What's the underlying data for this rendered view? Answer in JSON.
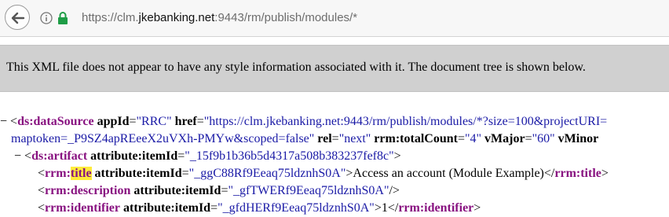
{
  "browser": {
    "url_prefix": "https://clm.",
    "url_host": "jkebanking.net",
    "url_suffix": ":9443/rm/publish/modules/*"
  },
  "notice": {
    "text": "This XML file does not appear to have any style information associated with it. The document tree is shown below."
  },
  "xml": {
    "toggle": "−",
    "lt": "<",
    "gt": ">",
    "close_lt": "</",
    "self_close": "/>",
    "eq": "=",
    "line1": {
      "tag": "ds:dataSource",
      "attr1": "appId",
      "val1": "\"RRC\"",
      "attr2": "href",
      "val2": "\"https://clm.jkebanking.net:9443/rm/publish/modules/*?size=100&projectURI="
    },
    "line2": {
      "val2_cont": "maptoken=_P9SZ4apREeeX2uVXh-PMYw&scoped=false\"",
      "attr3": "rel",
      "val3": "\"next\"",
      "attr4": "rrm:totalCount",
      "val4": "\"4\"",
      "attr5": "vMajor",
      "val5": "\"60\"",
      "attr6": "vMinor"
    },
    "line3": {
      "tag": "ds:artifact",
      "attr": "attribute:itemId",
      "val": "\"_15f9b1b36b5d4317a508b383237fef8c\""
    },
    "line4": {
      "tag_prefix": "rrm:",
      "tag_hl": "title",
      "attr": "attribute:itemId",
      "val": "\"_ggC88Rf9Eeaq75ldznhS0A\"",
      "text": "Access an account (Module Example)",
      "close_tag": "rrm:title"
    },
    "line5": {
      "tag": "rrm:description",
      "attr": "attribute:itemId",
      "val": "\"_gfTWERf9Eeaq75ldznhS0A\""
    },
    "line6": {
      "tag": "rrm:identifier",
      "attr": "attribute:itemId",
      "val": "\"_gfdHERf9Eeaq75ldznhS0A\"",
      "text": "1",
      "close_tag": "rrm:identifier"
    }
  }
}
